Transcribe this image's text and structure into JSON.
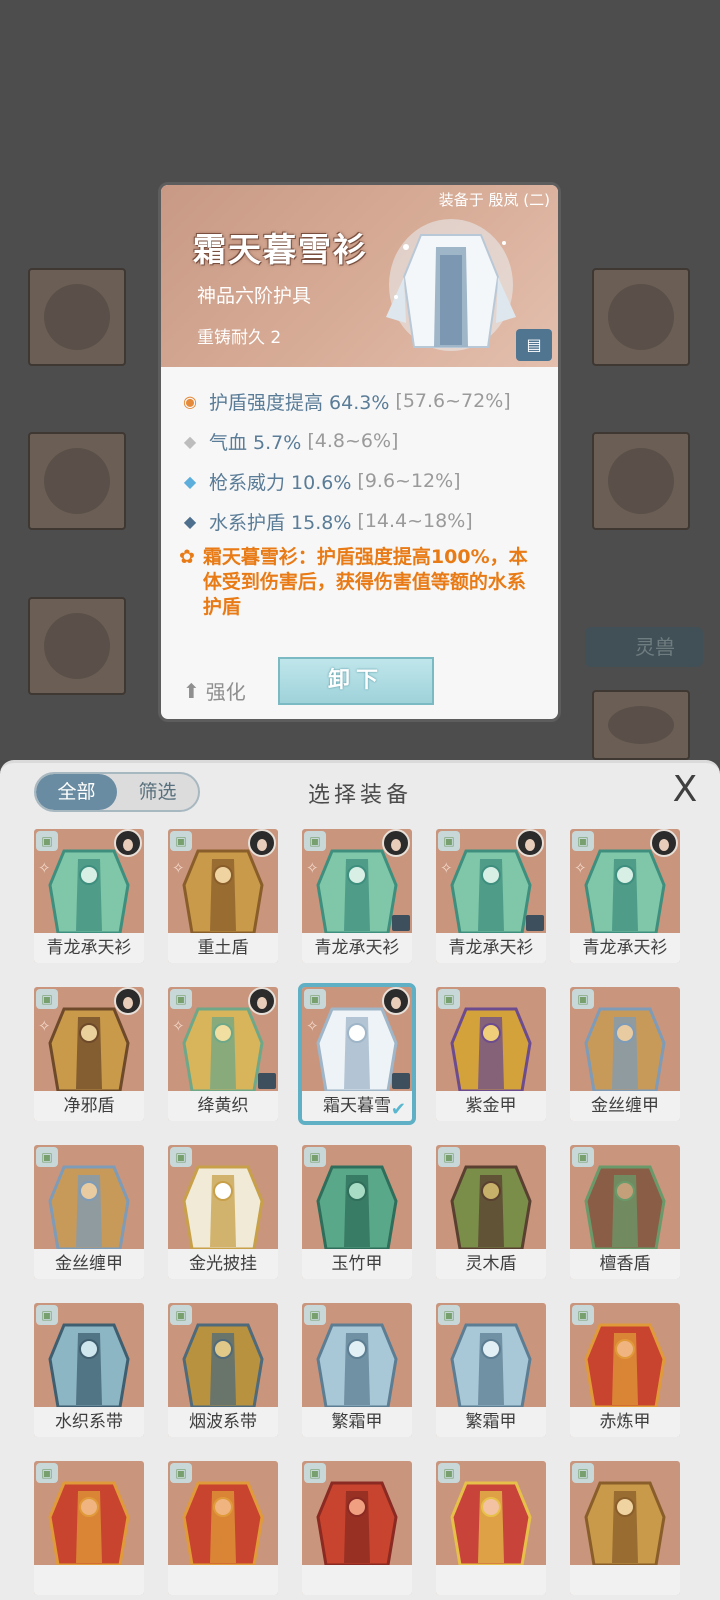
{
  "background": {
    "tag_label": "灵兽"
  },
  "detail": {
    "equipped_by": "装备于 殷岚 (二)",
    "title": "霜天暮雪衫",
    "grade": "神品六阶护具",
    "recast": "重铸耐久 2",
    "attributes": [
      {
        "icon": "flame-icon",
        "text": "护盾强度提高 64.3%",
        "range": "[57.6~72%]"
      },
      {
        "icon": "diamond-grey-icon",
        "text": "气血 5.7%",
        "range": "[4.8~6%]"
      },
      {
        "icon": "diamond-blue-icon",
        "text": "枪系威力 10.6%",
        "range": "[9.6~12%]"
      },
      {
        "icon": "diamond-navy-icon",
        "text": "水系护盾 15.8%",
        "range": "[14.4~18%]"
      }
    ],
    "effect": "霜天暮雪衫：护盾强度提高100%，本体受到伤害后，获得伤害值等额的水系护盾",
    "upgrade_label": "强化",
    "unequip_label": "卸下",
    "colors": {
      "attr": "#5a7c97",
      "effect": "#e87b16",
      "range": "#9a9a9a"
    }
  },
  "panel": {
    "tabs": [
      {
        "label": "全部",
        "active": true
      },
      {
        "label": "筛选",
        "active": false
      }
    ],
    "title": "选择装备",
    "close_glyph": "X",
    "items": [
      {
        "name": "青龙承天衫",
        "art": "robe-green",
        "avatar": true,
        "locked": false
      },
      {
        "name": "重土盾",
        "art": "shield-gold",
        "avatar": true,
        "locked": false
      },
      {
        "name": "青龙承天衫",
        "art": "robe-green",
        "avatar": true,
        "locked": true
      },
      {
        "name": "青龙承天衫",
        "art": "robe-green",
        "avatar": true,
        "locked": true
      },
      {
        "name": "青龙承天衫",
        "art": "robe-green",
        "avatar": true,
        "locked": false
      },
      {
        "name": "净邪盾",
        "art": "armor-gold",
        "avatar": true,
        "locked": false
      },
      {
        "name": "绛黄织",
        "art": "robe-yellow",
        "avatar": true,
        "locked": true
      },
      {
        "name": "霜天暮雪",
        "art": "robe-white",
        "avatar": true,
        "locked": true,
        "selected": true
      },
      {
        "name": "紫金甲",
        "art": "armor-purple",
        "avatar": false,
        "locked": false
      },
      {
        "name": "金丝缠甲",
        "art": "vest-gold",
        "avatar": false,
        "locked": false
      },
      {
        "name": "金丝缠甲",
        "art": "vest-gold",
        "avatar": false,
        "locked": false
      },
      {
        "name": "金光披挂",
        "art": "cape-gold",
        "avatar": false,
        "locked": false
      },
      {
        "name": "玉竹甲",
        "art": "armor-jade",
        "avatar": false,
        "locked": false
      },
      {
        "name": "灵木盾",
        "art": "shield-wood",
        "avatar": false,
        "locked": false
      },
      {
        "name": "檀香盾",
        "art": "shield-sandal",
        "avatar": false,
        "locked": false
      },
      {
        "name": "水织系带",
        "art": "belt-water",
        "avatar": false,
        "locked": false
      },
      {
        "name": "烟波系带",
        "art": "belt-smoke",
        "avatar": false,
        "locked": false
      },
      {
        "name": "繁霜甲",
        "art": "armor-frost",
        "avatar": false,
        "locked": false
      },
      {
        "name": "繁霜甲",
        "art": "armor-frost",
        "avatar": false,
        "locked": false
      },
      {
        "name": "赤炼甲",
        "art": "armor-red",
        "avatar": false,
        "locked": false
      },
      {
        "name": "",
        "art": "armor-red",
        "avatar": false,
        "locked": false
      },
      {
        "name": "",
        "art": "armor-red",
        "avatar": false,
        "locked": false
      },
      {
        "name": "",
        "art": "belt-red",
        "avatar": false,
        "locked": false
      },
      {
        "name": "",
        "art": "robe-red",
        "avatar": false,
        "locked": false
      },
      {
        "name": "",
        "art": "shield-gold",
        "avatar": false,
        "locked": false
      }
    ]
  }
}
